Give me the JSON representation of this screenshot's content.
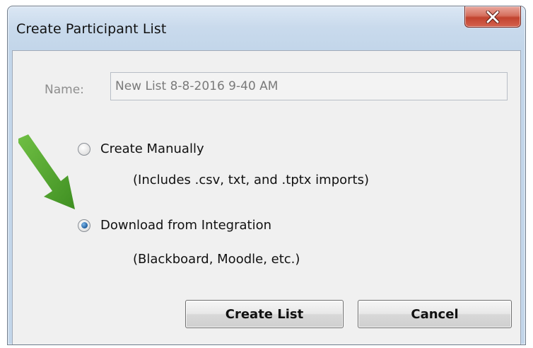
{
  "window": {
    "title": "Create Participant List"
  },
  "form": {
    "name_label": "Name:",
    "name_value": "New List 8-8-2016 9-40 AM",
    "options": [
      {
        "label": "Create Manually",
        "note": "(Includes .csv, txt, and .tptx imports)",
        "selected": false
      },
      {
        "label": "Download from Integration",
        "note": "(Blackboard, Moodle, etc.)",
        "selected": true
      }
    ]
  },
  "buttons": {
    "create_label": "Create List",
    "cancel_label": "Cancel"
  },
  "colors": {
    "annotation_arrow": "#5aa833",
    "close_button": "#c9513d",
    "radio_selected": "#1e5d9e"
  },
  "icons": {
    "close": "close-x-icon",
    "annotation": "green-arrow-icon"
  }
}
